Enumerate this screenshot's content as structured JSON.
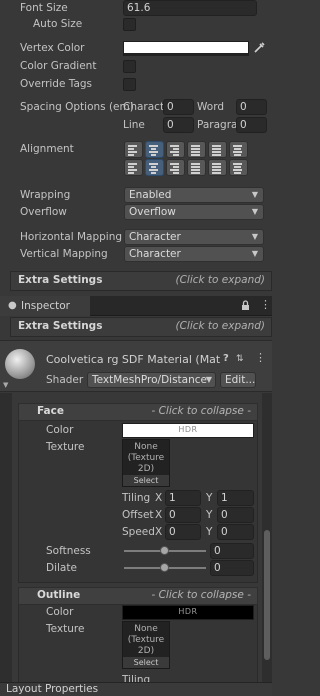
{
  "font_settings": {
    "font_size_label": "Font Size",
    "font_size_value": "61.6",
    "auto_size_label": "Auto Size",
    "vertex_color_label": "Vertex Color",
    "vertex_color": "#ffffff",
    "color_gradient_label": "Color Gradient",
    "override_tags_label": "Override Tags"
  },
  "spacing": {
    "label": "Spacing Options (em)",
    "character_label": "Charact",
    "character_value": "0",
    "word_label": "Word",
    "word_value": "0",
    "line_label": "Line",
    "line_value": "0",
    "paragraph_label": "Paragra",
    "paragraph_value": "0"
  },
  "alignment": {
    "label": "Alignment",
    "horizontal_buttons": [
      "align-left",
      "align-center",
      "align-right",
      "align-justified",
      "align-flush",
      "align-geometry-center"
    ],
    "horizontal_selected": 1,
    "vertical_buttons": [
      "align-top",
      "align-middle",
      "align-bottom",
      "align-baseline",
      "align-midline",
      "align-capline"
    ],
    "vertical_selected": 1
  },
  "wrapping": {
    "wrapping_label": "Wrapping",
    "wrapping_value": "Enabled",
    "overflow_label": "Overflow",
    "overflow_value": "Overflow"
  },
  "mapping": {
    "horizontal_label": "Horizontal Mapping",
    "horizontal_value": "Character",
    "vertical_label": "Vertical Mapping",
    "vertical_value": "Character"
  },
  "extra_settings_top": {
    "title": "Extra Settings",
    "hint": "(Click to expand)"
  },
  "inspector": {
    "tab_label": "Inspector",
    "info_icon": "info-icon",
    "lock_icon": "lock-icon",
    "menu_icon": "kebab-menu-icon"
  },
  "extra_settings_bottom": {
    "title": "Extra Settings",
    "hint": "(Click to expand)"
  },
  "material": {
    "name": "Coolvetica rg SDF Material (Mat",
    "shader_label": "Shader",
    "shader_value": "TextMeshPro/Distance",
    "edit_label": "Edit...",
    "help_icon": "help-icon",
    "settings_icon": "settings-sliders-icon",
    "menu_icon": "kebab-menu-icon"
  },
  "face": {
    "title": "Face",
    "hint": "- Click to collapse -",
    "color_label": "Color",
    "color_value": "#ffffff",
    "color_badge": "HDR",
    "texture_label": "Texture",
    "texture_slot_text": [
      "None",
      "(Texture",
      "2D)"
    ],
    "texture_select": "Select",
    "tiling_label": "Tiling",
    "tiling_x": "1",
    "tiling_y": "1",
    "offset_label": "Offset",
    "offset_x": "0",
    "offset_y": "0",
    "speed_label": "Speed",
    "speed_x": "0",
    "speed_y": "0",
    "x_label": "X",
    "y_label": "Y",
    "softness_label": "Softness",
    "softness_value": "0",
    "softness_level": 0.5,
    "dilate_label": "Dilate",
    "dilate_value": "0",
    "dilate_level": 0.5
  },
  "outline": {
    "title": "Outline",
    "hint": "- Click to collapse -",
    "color_label": "Color",
    "color_value": "#000000",
    "color_badge": "HDR",
    "texture_label": "Texture",
    "texture_slot_text": [
      "None",
      "(Texture",
      "2D)"
    ],
    "texture_select": "Select",
    "tiling_label": "Tiling"
  },
  "layout_properties": {
    "title": "Layout Properties"
  }
}
